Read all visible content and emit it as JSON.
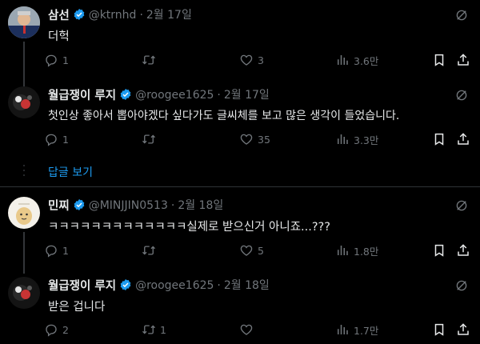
{
  "colors": {
    "background": "#000000",
    "text": "#e7e9ea",
    "muted": "#71767b",
    "link": "#1d9bf0",
    "verified": "#1d9bf0"
  },
  "tweets": [
    {
      "name": "삼선",
      "handle": "@ktrnhd",
      "date": "2월 17일",
      "verified": true,
      "text": "더헉",
      "replies": "1",
      "retweets": "",
      "likes": "3",
      "views": "3.6만"
    },
    {
      "name": "월급쟁이 루지",
      "handle": "@roogee1625",
      "date": "2월 17일",
      "verified": true,
      "text": "첫인상 좋아서 뽑아야겠다 싶다가도 글씨체를 보고 많은 생각이 들었습니다.",
      "replies": "1",
      "retweets": "",
      "likes": "35",
      "views": "3.3만"
    },
    {
      "name": "민찌",
      "handle": "@MINJJIN0513",
      "date": "2월 18일",
      "verified": true,
      "text": "ㅋㅋㅋㅋㅋㅋㅋㅋㅋㅋㅋㅋㅋ실제로 받으신거 아니죠...???",
      "replies": "1",
      "retweets": "",
      "likes": "5",
      "views": "1.8만"
    },
    {
      "name": "월급쟁이 루지",
      "handle": "@roogee1625",
      "date": "2월 18일",
      "verified": true,
      "text": "받은 겁니다",
      "replies": "2",
      "retweets": "1",
      "likes": "",
      "views": "1.7만"
    }
  ],
  "show_replies_label": "답글 보기",
  "icons": [
    "more-icon",
    "reply-icon",
    "retweet-icon",
    "like-icon",
    "views-icon",
    "bookmark-icon",
    "share-icon",
    "verified-badge-icon"
  ]
}
